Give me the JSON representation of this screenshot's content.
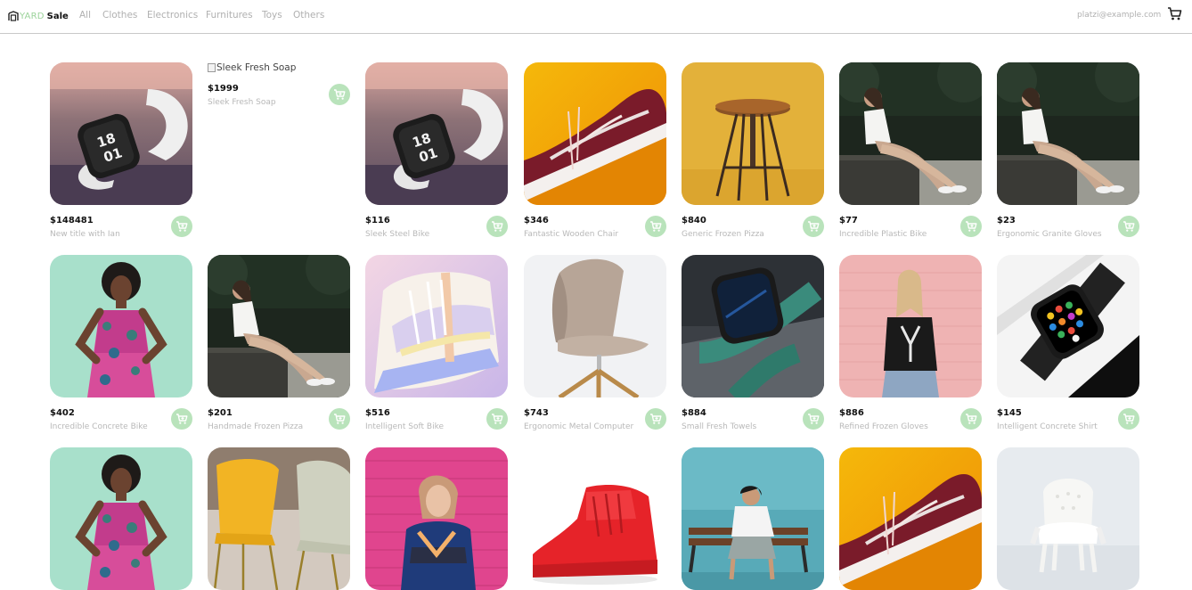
{
  "nav": {
    "logo_yard": "YARD",
    "logo_sale": "Sale",
    "links": [
      "All",
      "Clothes",
      "Electronics",
      "Furnitures",
      "Toys",
      "Others"
    ],
    "email": "platzi@example.com",
    "cart_icon": "cart-icon"
  },
  "products": [
    {
      "price": "$148481",
      "title": "New title with Ian",
      "image": "smartwatch-white"
    },
    {
      "price": "$1999",
      "title": "Sleek Fresh Soap",
      "image_alt": "Sleek Fresh Soap",
      "image": "broken"
    },
    {
      "price": "$116",
      "title": "Sleek Steel Bike",
      "image": "smartwatch-white"
    },
    {
      "price": "$346",
      "title": "Fantastic Wooden Chair",
      "image": "maroon-sneaker"
    },
    {
      "price": "$840",
      "title": "Generic Frozen Pizza",
      "image": "wooden-stool"
    },
    {
      "price": "$77",
      "title": "Incredible Plastic Bike",
      "image": "woman-bench"
    },
    {
      "price": "$23",
      "title": "Ergonomic Granite Gloves",
      "image": "woman-bench"
    },
    {
      "price": "$402",
      "title": "Incredible Concrete Bike",
      "image": "woman-dress"
    },
    {
      "price": "$201",
      "title": "Handmade Frozen Pizza",
      "image": "woman-bench"
    },
    {
      "price": "$516",
      "title": "Intelligent Soft Bike",
      "image": "pastel-sneaker"
    },
    {
      "price": "$743",
      "title": "Ergonomic Metal Computer",
      "image": "fabric-chair"
    },
    {
      "price": "$884",
      "title": "Small Fresh Towels",
      "image": "smartwatch-green"
    },
    {
      "price": "$886",
      "title": "Refined Frozen Gloves",
      "image": "woman-pink-wall"
    },
    {
      "price": "$145",
      "title": "Intelligent Concrete Shirt",
      "image": "smartwatch-black"
    },
    {
      "price": "",
      "title": "",
      "image": "woman-dress"
    },
    {
      "price": "",
      "title": "",
      "image": "yellow-chairs"
    },
    {
      "price": "",
      "title": "",
      "image": "woman-magenta-wall"
    },
    {
      "price": "",
      "title": "",
      "image": "red-sneaker"
    },
    {
      "price": "",
      "title": "",
      "image": "man-bench-blue"
    },
    {
      "price": "",
      "title": "",
      "image": "maroon-sneaker"
    },
    {
      "price": "",
      "title": "",
      "image": "white-chair"
    }
  ],
  "colors": {
    "accent": "#acd9b2",
    "accent_button": "#b9e3bb",
    "muted_text": "#b0b0b0"
  }
}
